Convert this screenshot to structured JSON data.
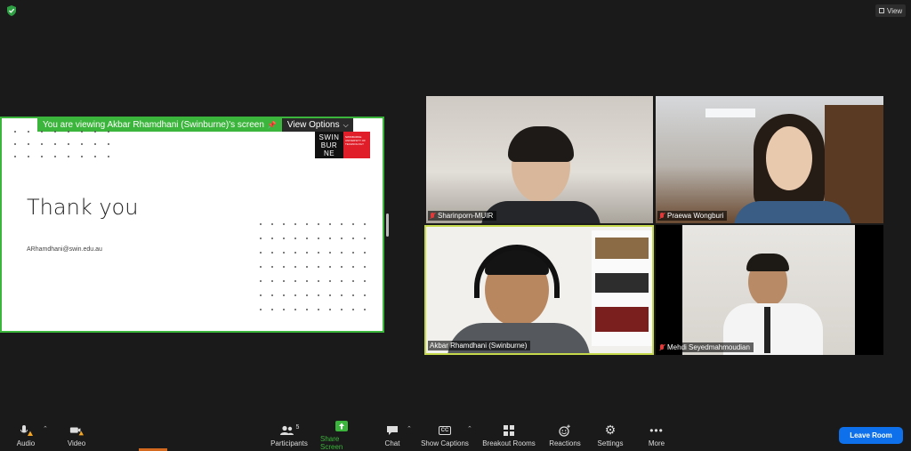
{
  "top": {
    "view_label": "View"
  },
  "share": {
    "banner": "You are viewing Akbar Rhamdhani (Swinburne)'s screen",
    "view_options": "View Options",
    "slide_title": "Thank you",
    "email": "ARhamdhani@swin.edu.au",
    "logo_text": "SWIN BUR NE",
    "logo_sub": "SWINBURNE UNIVERSITY OF TECHNOLOGY"
  },
  "participants": [
    {
      "name": "Sharinporn-MUIR",
      "muted": true
    },
    {
      "name": "Praewa Wongburi",
      "muted": true
    },
    {
      "name": "Akbar Rhamdhani (Swinburne)",
      "muted": false
    },
    {
      "name": "Mehdi Seyedmahmoudian",
      "muted": true
    }
  ],
  "toolbar": {
    "audio": "Audio",
    "video": "Video",
    "participants": "Participants",
    "participants_count": "5",
    "share_screen": "Share Screen",
    "chat": "Chat",
    "captions": "Show Captions",
    "captions_icon": "CC",
    "breakout": "Breakout Rooms",
    "reactions": "Reactions",
    "settings": "Settings",
    "more": "More",
    "leave": "Leave Room"
  },
  "colors": {
    "accent_green": "#3bb53b",
    "leave_blue": "#0e71eb",
    "active_speaker": "#c6d94a"
  }
}
